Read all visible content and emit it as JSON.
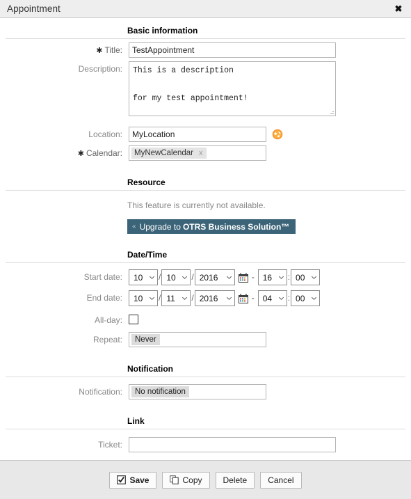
{
  "dialog": {
    "title": "Appointment",
    "close_icon": "close-icon",
    "close_label": "✖"
  },
  "sections": {
    "basic": {
      "title": "Basic information"
    },
    "resource": {
      "title": "Resource",
      "notice": "This feature is currently not available.",
      "upgrade_chevron": "«",
      "upgrade_prefix": "Upgrade to",
      "upgrade_product": "OTRS Business Solution™"
    },
    "datetime": {
      "title": "Date/Time"
    },
    "notification": {
      "title": "Notification"
    },
    "link": {
      "title": "Link"
    }
  },
  "fields": {
    "title": {
      "label": "Title:",
      "required_marker": "✱",
      "value": "TestAppointment",
      "placeholder": ""
    },
    "description": {
      "label": "Description:",
      "value": "This is a description\n\nfor my test appointment!",
      "placeholder": ""
    },
    "location": {
      "label": "Location:",
      "value": "MyLocation",
      "placeholder": "",
      "map_icon": "globe-icon"
    },
    "calendar": {
      "label": "Calendar:",
      "required_marker": "✱",
      "tag": "MyNewCalendar",
      "tag_remove": "x"
    },
    "start_date": {
      "label": "Start date:",
      "day": "10",
      "month": "10",
      "year": "2016",
      "hour": "16",
      "minute": "00",
      "date_sep": "/",
      "time_sep": ":",
      "range_dash": "-",
      "calendar_icon": "calendar-icon"
    },
    "end_date": {
      "label": "End date:",
      "day": "10",
      "month": "11",
      "year": "2016",
      "hour": "04",
      "minute": "00",
      "date_sep": "/",
      "time_sep": ":",
      "range_dash": "-",
      "calendar_icon": "calendar-icon"
    },
    "all_day": {
      "label": "All-day:",
      "checked": false
    },
    "repeat": {
      "label": "Repeat:",
      "value": "Never"
    },
    "notification": {
      "label": "Notification:",
      "value": "No notification"
    },
    "ticket": {
      "label": "Ticket:",
      "value": "",
      "placeholder": ""
    }
  },
  "footer": {
    "save": "Save",
    "copy": "Copy",
    "delete": "Delete",
    "cancel": "Cancel"
  },
  "colors": {
    "titlebar_bg": "#eeeeee",
    "footer_bg": "#e8e8e8",
    "upgrade_bg": "#3c6478",
    "globe_orange": "#f5a623",
    "label_gray": "#888888",
    "rule_gray": "#dddddd"
  }
}
